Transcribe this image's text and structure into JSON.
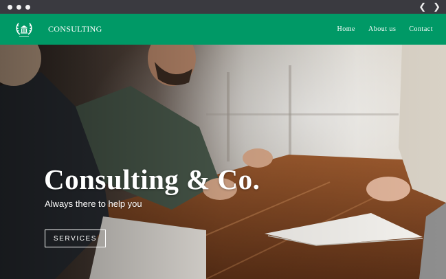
{
  "header": {
    "brand": "CONSULTING",
    "logo_icon": "laurel-building-logo-icon",
    "nav": [
      {
        "label": "Home"
      },
      {
        "label": "About us"
      },
      {
        "label": "Contact"
      }
    ]
  },
  "hero": {
    "title": "Consulting & Co.",
    "subtitle": "Always there to help you",
    "button_label": "SERVICES"
  },
  "colors": {
    "header_bg": "#009966",
    "chrome_bg": "#3a3a40"
  },
  "icons": {
    "back": "chevron-left-icon",
    "forward": "chevron-right-icon"
  }
}
